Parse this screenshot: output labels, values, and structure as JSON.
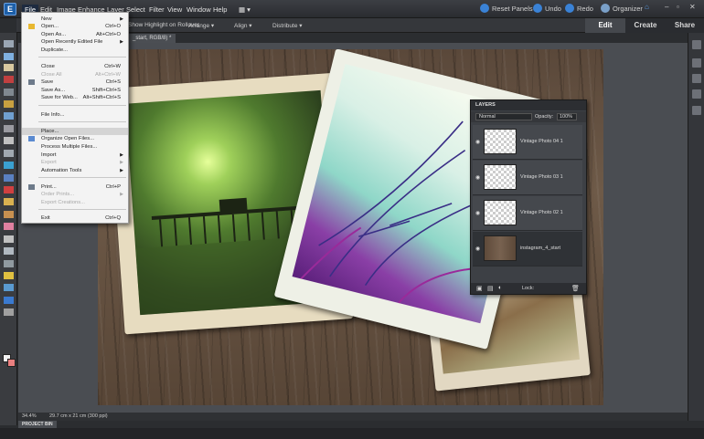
{
  "menubar": {
    "logo": "E",
    "items": [
      "File",
      "Edit",
      "Image",
      "Enhance",
      "Layer",
      "Select",
      "Filter",
      "View",
      "Window",
      "Help"
    ],
    "reset_panels": "Reset Panels",
    "undo": "Undo",
    "redo": "Redo",
    "organizer": "Organizer"
  },
  "modes": {
    "edit": "Edit",
    "create": "Create",
    "share": "Share"
  },
  "options_bar": {
    "highlight": "Show Highlight on Rollover",
    "arrange": "Arrange",
    "align": "Align",
    "distribute": "Distribute"
  },
  "doc_tab": "_start, RGB/8) *",
  "file_menu": {
    "items": [
      {
        "label": "New",
        "shortcut": "",
        "submenu": true,
        "enabled": true
      },
      {
        "label": "Open...",
        "shortcut": "Ctrl+O",
        "submenu": false,
        "enabled": true
      },
      {
        "label": "Open As...",
        "shortcut": "Alt+Ctrl+O",
        "submenu": false,
        "enabled": true
      },
      {
        "label": "Open Recently Edited File",
        "shortcut": "",
        "submenu": true,
        "enabled": true
      },
      {
        "label": "Duplicate...",
        "shortcut": "",
        "submenu": false,
        "enabled": true
      },
      {
        "label": "Close",
        "shortcut": "Ctrl+W",
        "submenu": false,
        "enabled": true
      },
      {
        "label": "Close All",
        "shortcut": "Alt+Ctrl+W",
        "submenu": false,
        "enabled": false
      },
      {
        "label": "Save",
        "shortcut": "Ctrl+S",
        "submenu": false,
        "enabled": true
      },
      {
        "label": "Save As...",
        "shortcut": "Shift+Ctrl+S",
        "submenu": false,
        "enabled": true
      },
      {
        "label": "Save for Web...",
        "shortcut": "Alt+Shift+Ctrl+S",
        "submenu": false,
        "enabled": true
      },
      {
        "label": "File Info...",
        "shortcut": "",
        "submenu": false,
        "enabled": true
      },
      {
        "label": "Place...",
        "shortcut": "",
        "submenu": false,
        "enabled": true
      },
      {
        "label": "Organize Open Files...",
        "shortcut": "",
        "submenu": false,
        "enabled": true
      },
      {
        "label": "Process Multiple Files...",
        "shortcut": "",
        "submenu": false,
        "enabled": true
      },
      {
        "label": "Import",
        "shortcut": "",
        "submenu": true,
        "enabled": true
      },
      {
        "label": "Export",
        "shortcut": "",
        "submenu": true,
        "enabled": false
      },
      {
        "label": "Automation Tools",
        "shortcut": "",
        "submenu": true,
        "enabled": true
      },
      {
        "label": "Print...",
        "shortcut": "Ctrl+P",
        "submenu": false,
        "enabled": true
      },
      {
        "label": "Order Prints...",
        "shortcut": "",
        "submenu": true,
        "enabled": false
      },
      {
        "label": "Export Creations...",
        "shortcut": "",
        "submenu": false,
        "enabled": false
      },
      {
        "label": "Exit",
        "shortcut": "Ctrl+Q",
        "submenu": false,
        "enabled": true
      }
    ]
  },
  "layers_panel": {
    "title": "LAYERS",
    "blend_mode": "Normal",
    "opacity_label": "Opacity:",
    "opacity_value": "100%",
    "lock_label": "Lock:",
    "layers": [
      {
        "name": "Vintage Photo 04 1",
        "selected": false
      },
      {
        "name": "Vintage Photo 03 1",
        "selected": false
      },
      {
        "name": "Vintage Photo 02 1",
        "selected": false
      },
      {
        "name": "instagram_4_start",
        "selected": true
      }
    ]
  },
  "status": {
    "zoom": "34.4%",
    "doc_size": "29.7 cm x 21 cm (300 ppi)",
    "project_bin": "PROJECT BIN"
  },
  "colors": {
    "foreground": "#f2f2f2",
    "background": "#ea8080",
    "accent": "#1d5fa8"
  }
}
